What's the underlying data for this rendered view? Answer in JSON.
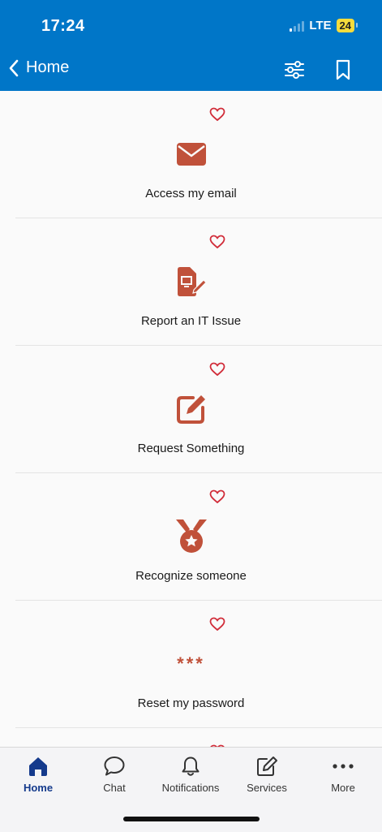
{
  "status_bar": {
    "time": "17:24",
    "network": "LTE",
    "battery": "24"
  },
  "nav": {
    "back_label": "Home"
  },
  "cards": [
    {
      "label": "Access my email",
      "icon": "envelope-icon"
    },
    {
      "label": "Report an IT Issue",
      "icon": "document-edit-icon"
    },
    {
      "label": "Request Something",
      "icon": "pencil-square-icon"
    },
    {
      "label": "Recognize someone",
      "icon": "medal-icon"
    },
    {
      "label": "Reset my password",
      "icon": "password-asterisks-icon",
      "glyph": "***"
    }
  ],
  "tabs": [
    {
      "label": "Home",
      "icon": "home-icon",
      "active": true
    },
    {
      "label": "Chat",
      "icon": "chat-bubble-icon"
    },
    {
      "label": "Notifications",
      "icon": "bell-icon"
    },
    {
      "label": "Services",
      "icon": "edit-icon"
    },
    {
      "label": "More",
      "icon": "more-dots-icon"
    }
  ],
  "colors": {
    "header": "#0076c8",
    "accent": "#c0513a",
    "heart": "#d12d3a",
    "active_tab": "#143a8c"
  }
}
